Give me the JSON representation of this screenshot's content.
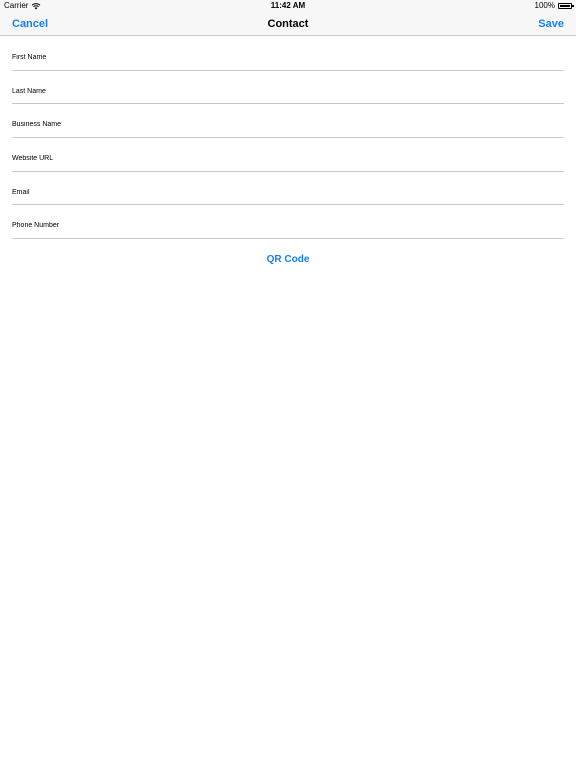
{
  "status_bar": {
    "carrier": "Carrier",
    "time": "11:42 AM",
    "battery": "100%",
    "wifi_icon": "wifi-icon",
    "battery_icon": "battery-icon"
  },
  "nav": {
    "cancel_label": "Cancel",
    "title": "Contact",
    "save_label": "Save"
  },
  "form": {
    "fields": [
      {
        "placeholder": "First Name",
        "value": ""
      },
      {
        "placeholder": "Last Name",
        "value": ""
      },
      {
        "placeholder": "Business Name",
        "value": ""
      },
      {
        "placeholder": "Website URL",
        "value": ""
      },
      {
        "placeholder": "Email",
        "value": ""
      },
      {
        "placeholder": "Phone Number",
        "value": ""
      }
    ]
  },
  "qr_code_label": "QR Code",
  "colors": {
    "accent": "#157efb",
    "bar_background": "#f7f7f7",
    "separator": "#c8c7cc"
  }
}
